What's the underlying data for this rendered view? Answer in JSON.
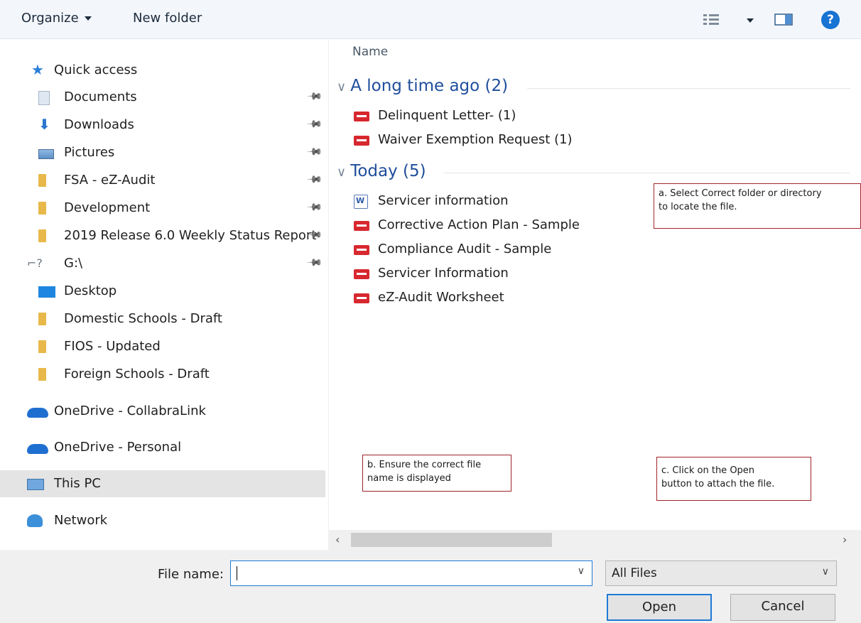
{
  "toolbar": {
    "organize_label": "Organize",
    "new_folder_label": "New folder",
    "help_label": "?"
  },
  "nav": {
    "items": [
      {
        "label": "Quick access",
        "icon": "star-icon"
      },
      {
        "label": "Documents",
        "icon": "documents-icon",
        "pinned": true
      },
      {
        "label": "Downloads",
        "icon": "download-arrow-icon",
        "pinned": true
      },
      {
        "label": "Pictures",
        "icon": "pictures-icon",
        "pinned": true
      },
      {
        "label": "FSA - eZ-Audit",
        "icon": "folder-icon",
        "pinned": true
      },
      {
        "label": "Development",
        "icon": "folder-icon",
        "pinned": true
      },
      {
        "label": "2019 Release 6.0 Weekly Status Report",
        "icon": "folder-icon",
        "pinned": true
      },
      {
        "label": "G:\\",
        "icon": "network-drive-icon",
        "pinned": true
      },
      {
        "label": "Desktop",
        "icon": "desktop-icon"
      },
      {
        "label": "Domestic Schools - Draft",
        "icon": "folder-icon"
      },
      {
        "label": "FIOS - Updated",
        "icon": "folder-icon"
      },
      {
        "label": "Foreign Schools - Draft",
        "icon": "folder-icon"
      },
      {
        "label": "OneDrive - CollabraLink",
        "icon": "onedrive-icon"
      },
      {
        "label": "OneDrive - Personal",
        "icon": "onedrive-icon"
      },
      {
        "label": "This PC",
        "icon": "this-pc-icon",
        "selected": true
      },
      {
        "label": "Network",
        "icon": "network-icon"
      }
    ]
  },
  "content": {
    "column_header": "Name",
    "groups": [
      {
        "title": "A long time ago (2)",
        "files": [
          {
            "name": "Delinquent Letter- (1)",
            "type": "pdf"
          },
          {
            "name": "Waiver Exemption Request (1)",
            "type": "pdf"
          }
        ]
      },
      {
        "title": "Today (5)",
        "files": [
          {
            "name": "Servicer information",
            "type": "word"
          },
          {
            "name": "Corrective Action Plan - Sample",
            "type": "pdf"
          },
          {
            "name": "Compliance Audit - Sample",
            "type": "pdf"
          },
          {
            "name": "Servicer Information",
            "type": "pdf"
          },
          {
            "name": "eZ-Audit Worksheet",
            "type": "pdf"
          }
        ]
      }
    ]
  },
  "callouts": {
    "a": "a. Select Correct folder or directory\nto locate the file.",
    "b": "b. Ensure the correct file\nname is displayed",
    "c": "c. Click on the Open\nbutton to attach the file."
  },
  "bottom": {
    "file_name_label": "File name:",
    "file_name_value": "",
    "filter_value": "All Files",
    "open_label": "Open",
    "cancel_label": "Cancel"
  },
  "colors": {
    "accent": "#1f7ad6",
    "group_heading": "#1f4e9b",
    "callout_border": "#a0242a",
    "pdf_icon": "#d8282f"
  }
}
